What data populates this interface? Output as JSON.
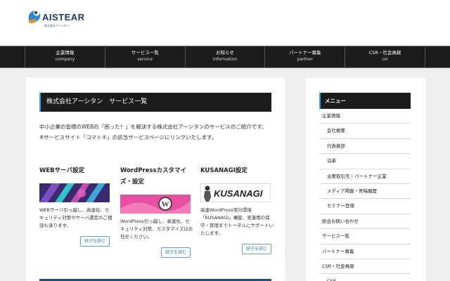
{
  "header": {
    "logo_text": "AISTEAR",
    "logo_sub": "株式会社アーシタン"
  },
  "nav": [
    {
      "ja": "企業情報",
      "en": "company"
    },
    {
      "ja": "サービス一覧",
      "en": "service"
    },
    {
      "ja": "お知らせ",
      "en": "information"
    },
    {
      "ja": "パートナー募集",
      "en": "partner"
    },
    {
      "ja": "CSR・社会貢献",
      "en": "csr"
    }
  ],
  "main": {
    "title": "株式会社アーシタン　サービス一覧",
    "intro_1": "中小企業の皆様のWEBの「困った！」を解決する株式会社アーシタンのサービスのご紹介です。",
    "intro_2": "※サービスサイト「コマトキ」の該当サービスページにリンクいたします。",
    "cards": [
      {
        "title": "WEBサーバ設定",
        "desc": "WEBサーバ引っ越し、高速化、セキュリティ対策やサーバ選定のご相談も承ります。",
        "button": "続きを読む"
      },
      {
        "title": "WordPressカスタマイズ・設定",
        "desc": "WordPress引っ越し、高速化、セキュリティ対策、カスタマイズはお任せください。",
        "button": "続きを読む"
      },
      {
        "title": "KUSANAGI設定",
        "desc": "高速WordPress実行環境「KUSANAGI」構築、実運用の保守・管理までトータルにサポートいたします。",
        "button": "続きを読む",
        "image_text": "KUSANAGI"
      }
    ]
  },
  "sidebar": {
    "title": "メニュー",
    "items": [
      {
        "label": "企業情報",
        "level": 1
      },
      {
        "label": "会社概要",
        "level": 2
      },
      {
        "label": "代表挨拶",
        "level": 2
      },
      {
        "label": "沿革",
        "level": 2
      },
      {
        "label": "主要取引先・パートナー企業",
        "level": 2
      },
      {
        "label": "メディア掲載・寄稿履歴",
        "level": 2
      },
      {
        "label": "セミナー登壇",
        "level": 2
      },
      {
        "label": "総合お問い合わせ",
        "level": 1
      },
      {
        "label": "サービス一覧",
        "level": 1
      },
      {
        "label": "パートナー募集",
        "level": 1
      },
      {
        "label": "CSR・社会貢献",
        "level": 1
      },
      {
        "label": "CSR",
        "level": 2
      }
    ]
  },
  "colors": {
    "nav_bg": "#1c1c1c",
    "accent": "#2ea7e0",
    "button_border": "#5aa0d0"
  }
}
